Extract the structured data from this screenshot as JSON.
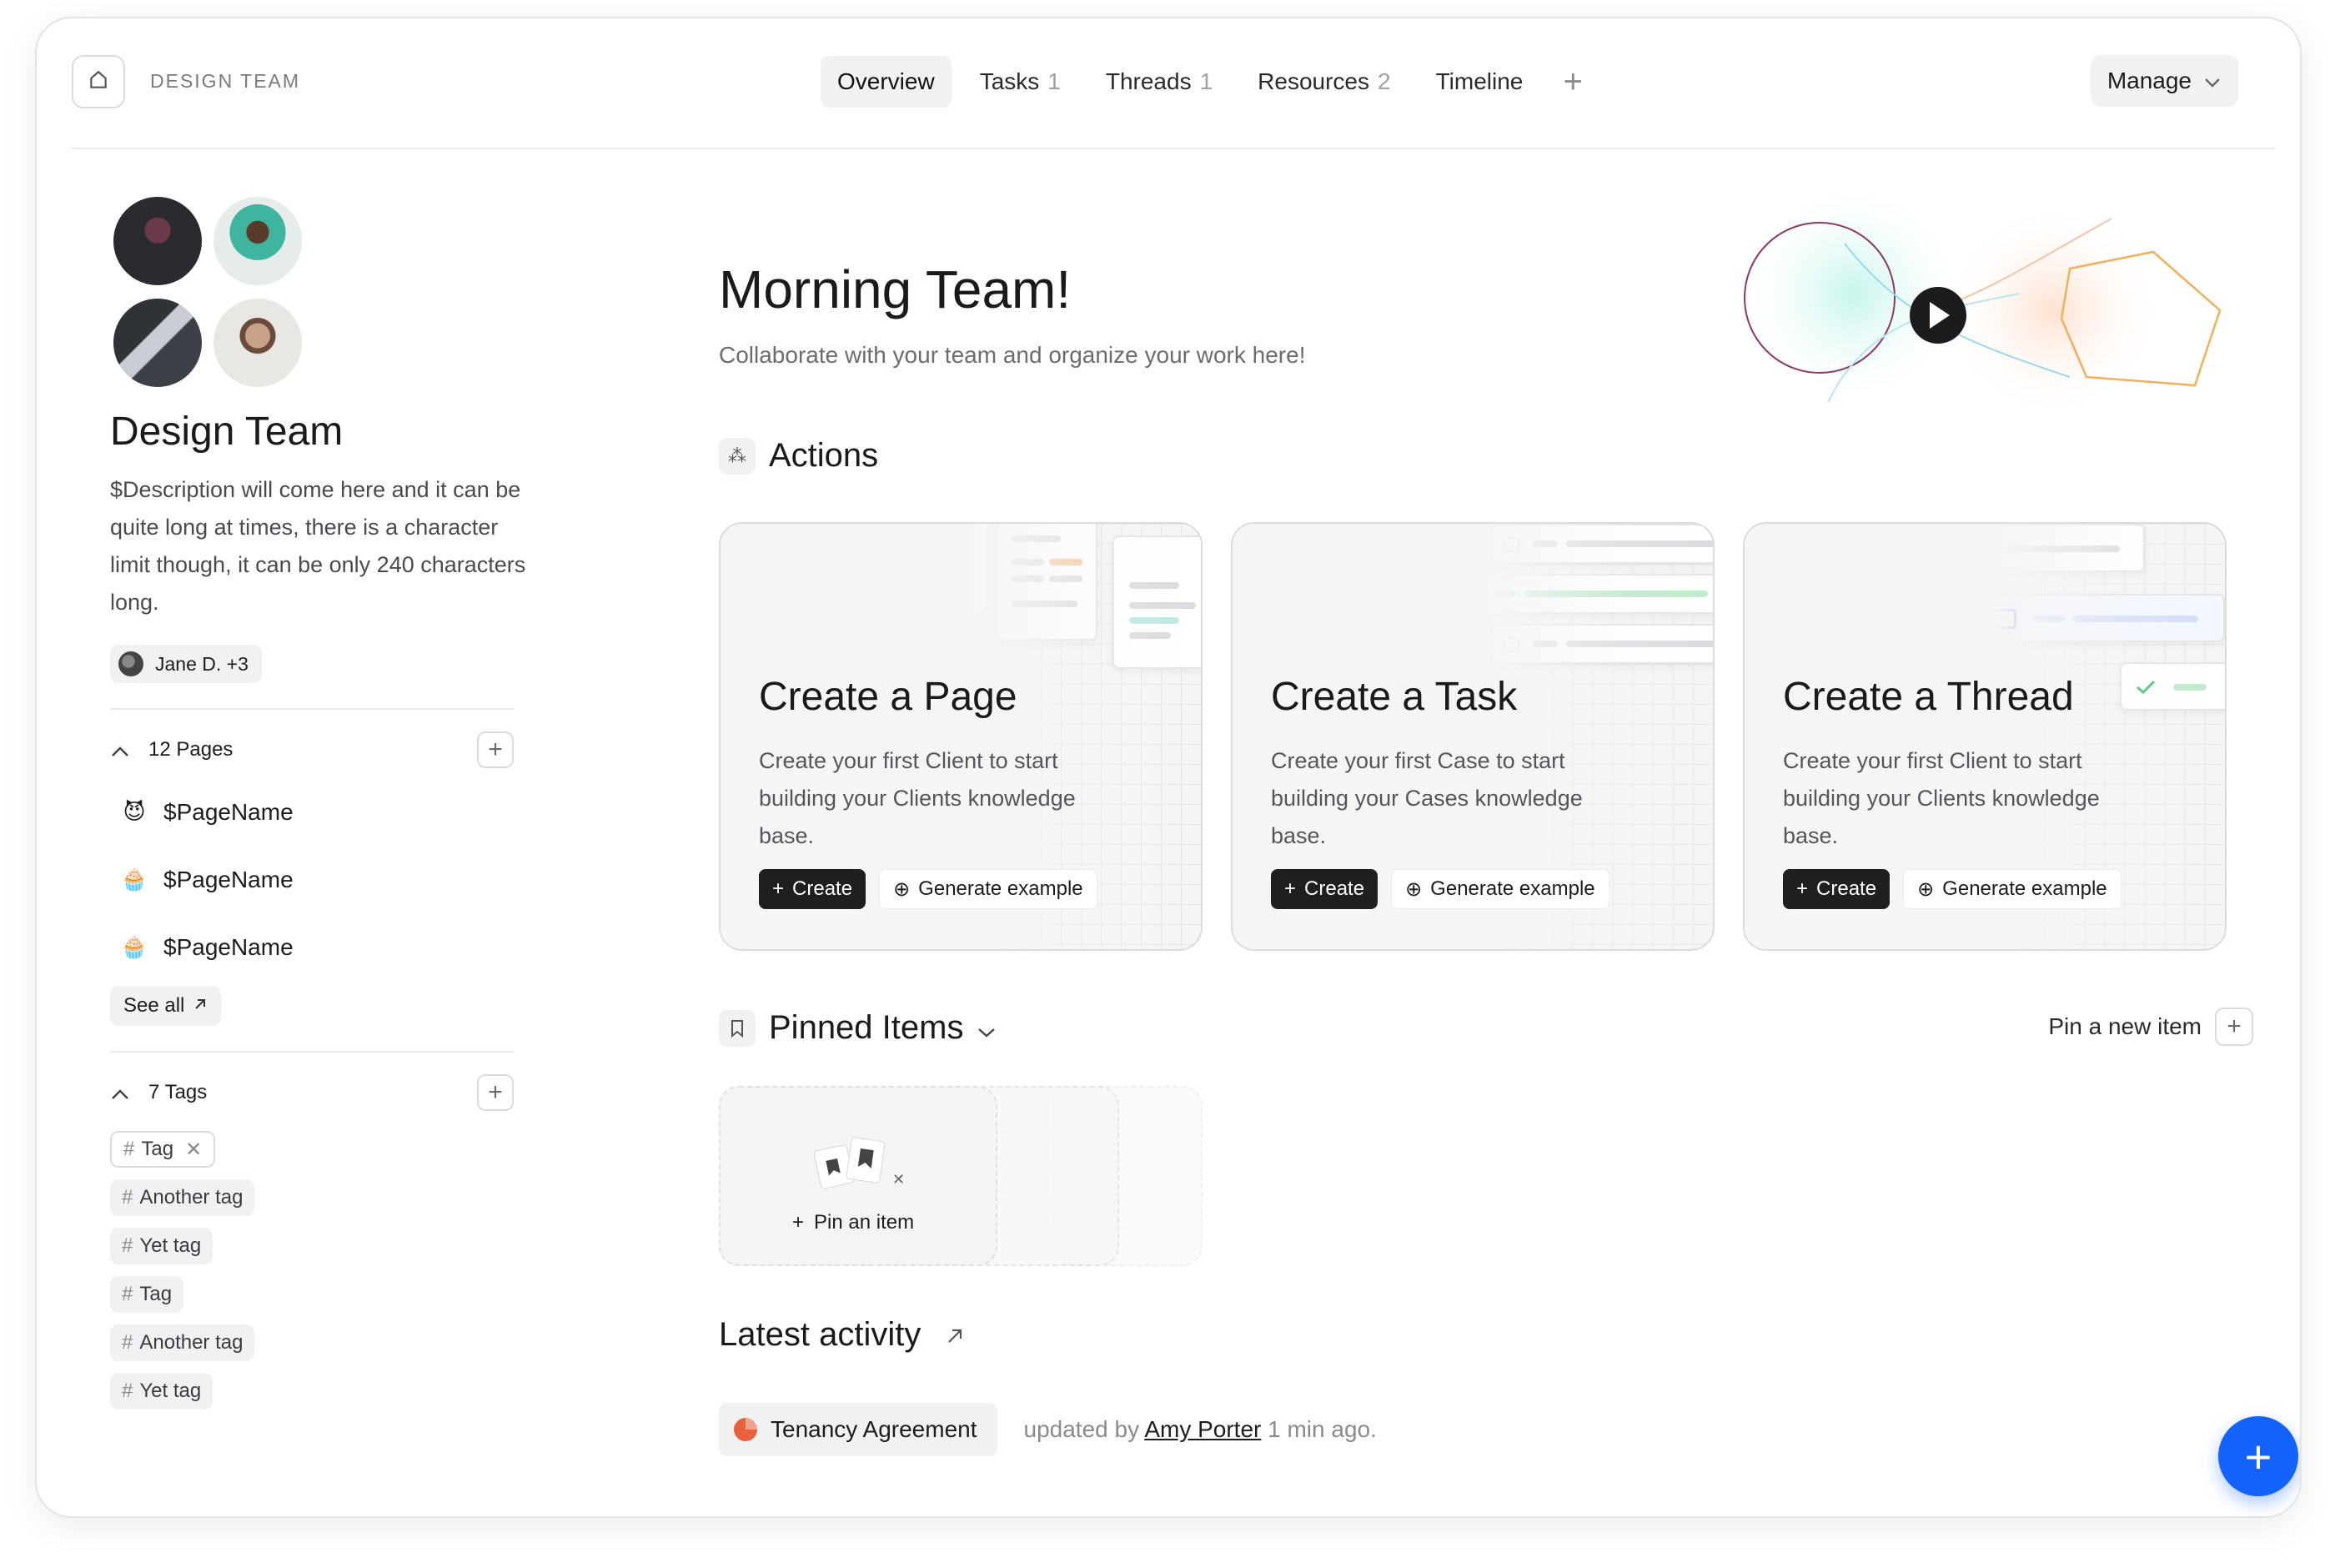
{
  "header": {
    "workspace": "DESIGN TEAM",
    "tabs": [
      {
        "label": "Overview",
        "count": ""
      },
      {
        "label": "Tasks",
        "count": "1"
      },
      {
        "label": "Threads",
        "count": "1"
      },
      {
        "label": "Resources",
        "count": "2"
      },
      {
        "label": "Timeline",
        "count": ""
      }
    ],
    "manage_label": "Manage"
  },
  "sidebar": {
    "team_name": "Design Team",
    "description": "$Description will come here and it can be quite long at times, there is a character limit though, it can be only 240 characters long.",
    "members_label": "Jane D. +3",
    "pages_label": "12 Pages",
    "pages": [
      {
        "emoji": "😈",
        "name": "$PageName"
      },
      {
        "emoji": "🧁",
        "name": "$PageName"
      },
      {
        "emoji": "🧁",
        "name": "$PageName"
      }
    ],
    "see_all": "See all",
    "tags_label": "7 Tags",
    "tags": [
      "Tag",
      "Another tag",
      "Yet tag",
      "Tag",
      "Another tag",
      "Yet tag"
    ]
  },
  "main": {
    "greeting": "Morning Team!",
    "subtitle": "Collaborate with your team and organize your work here!",
    "actions_title": "Actions",
    "cards": [
      {
        "title": "Create a Page",
        "desc": "Create your first Client to start building your Clients knowledge base.",
        "create": "Create",
        "generate": "Generate example"
      },
      {
        "title": "Create a Task",
        "desc": "Create your first Case to start building your Cases knowledge base.",
        "create": "Create",
        "generate": "Generate example"
      },
      {
        "title": "Create a Thread",
        "desc": "Create your first Client to start building your Clients knowledge base.",
        "create": "Create",
        "generate": "Generate example"
      }
    ],
    "pinned_title": "Pinned Items",
    "pin_new": "Pin a new item",
    "pin_item": "Pin an item",
    "activity_title": "Latest activity",
    "activity": {
      "doc": "Tenancy Agreement",
      "action": "updated by",
      "who": "Amy Porter",
      "when": "1 min ago."
    }
  },
  "colors": {
    "accent": "#1463ff",
    "dark_button": "#1f1f22",
    "success": "#3cc46c"
  }
}
